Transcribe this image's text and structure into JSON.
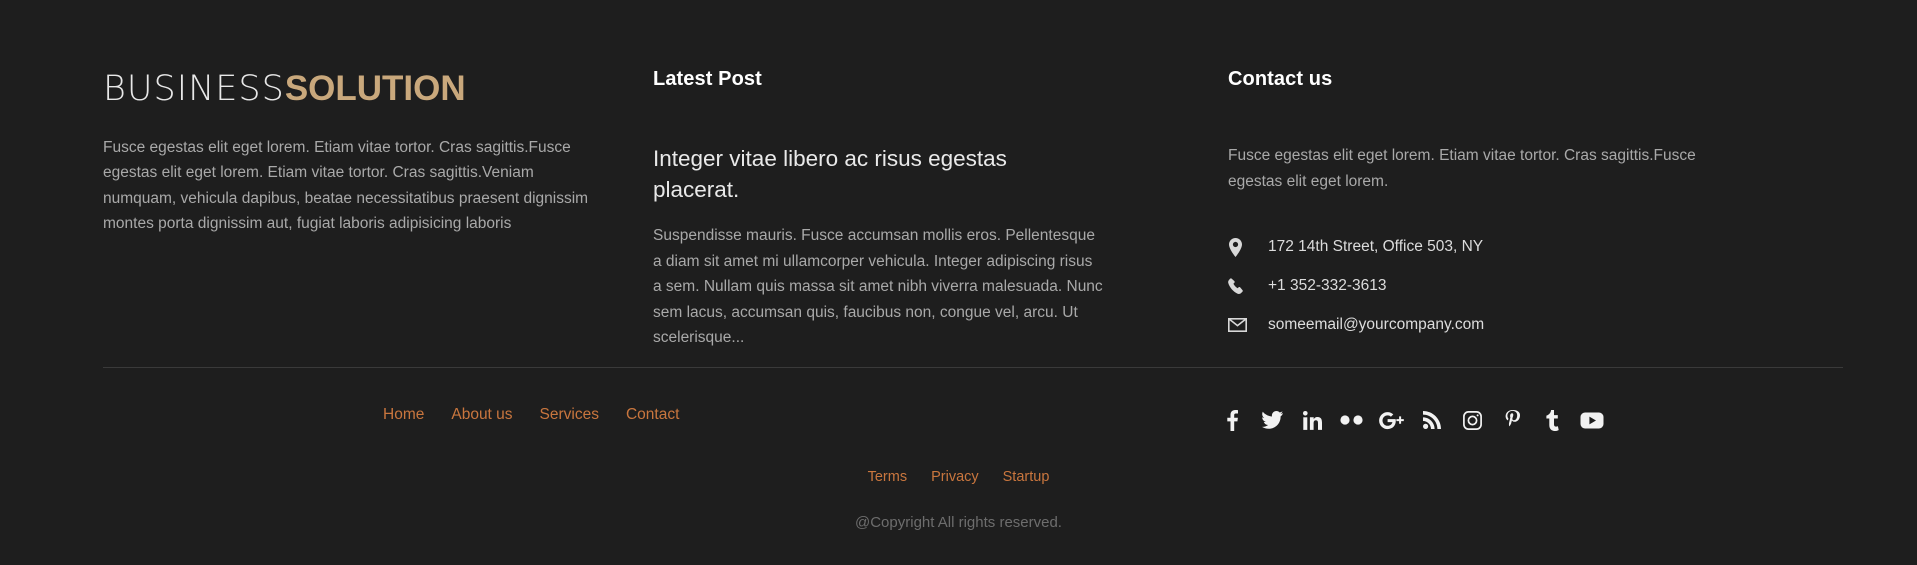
{
  "theme": {
    "background": "#1e1e1e",
    "accent_tan": "#c9a87c",
    "accent_orange": "#c9763e",
    "body_text": "#a9a9a9",
    "heading_text": "#ffffff",
    "divider": "#3a3a3a",
    "muted_text": "#6d6d6d"
  },
  "brand": {
    "logo_light": "BUSINESS",
    "logo_bold": "SOLUTION",
    "description": "Fusce egestas elit eget lorem. Etiam vitae tortor. Cras sagittis.Fusce egestas elit eget lorem. Etiam vitae tortor. Cras sagittis.Veniam numquam, vehicula dapibus, beatae necessitatibus praesent dignissim montes porta dignissim aut, fugiat laboris adipisicing laboris"
  },
  "latest_post": {
    "heading": "Latest Post",
    "title": "Integer vitae libero ac risus egestas placerat.",
    "body": "Suspendisse mauris. Fusce accumsan mollis eros. Pellentesque a diam sit amet mi ullamcorper vehicula. Integer adipiscing risus a sem. Nullam quis massa sit amet nibh viverra malesuada. Nunc sem lacus, accumsan quis, faucibus non, congue vel, arcu. Ut scelerisque..."
  },
  "contact": {
    "heading": "Contact us",
    "description": "Fusce egestas elit eget lorem. Etiam vitae tortor. Cras sagittis.Fusce egestas elit eget lorem.",
    "rows": [
      {
        "icon": "map-pin-icon",
        "value": "172 14th Street, Office 503, NY"
      },
      {
        "icon": "phone-icon",
        "value": "+1 352-332-3613"
      },
      {
        "icon": "envelope-icon",
        "value": "someemail@yourcompany.com"
      }
    ]
  },
  "nav": {
    "links": [
      {
        "label": "Home"
      },
      {
        "label": "About us"
      },
      {
        "label": "Services"
      },
      {
        "label": "Contact"
      }
    ]
  },
  "social": {
    "items": [
      {
        "name": "facebook-icon",
        "label": "Facebook"
      },
      {
        "name": "twitter-icon",
        "label": "Twitter"
      },
      {
        "name": "linkedin-icon",
        "label": "LinkedIn"
      },
      {
        "name": "flickr-icon",
        "label": "Flickr"
      },
      {
        "name": "google-plus-icon",
        "label": "Google Plus"
      },
      {
        "name": "rss-icon",
        "label": "RSS"
      },
      {
        "name": "instagram-icon",
        "label": "Instagram"
      },
      {
        "name": "pinterest-icon",
        "label": "Pinterest"
      },
      {
        "name": "tumblr-icon",
        "label": "Tumblr"
      },
      {
        "name": "youtube-icon",
        "label": "YouTube"
      }
    ]
  },
  "bottom": {
    "links": [
      {
        "label": "Terms"
      },
      {
        "label": "Privacy"
      },
      {
        "label": "Startup"
      }
    ],
    "copyright": "@Copyright All rights reserved."
  }
}
